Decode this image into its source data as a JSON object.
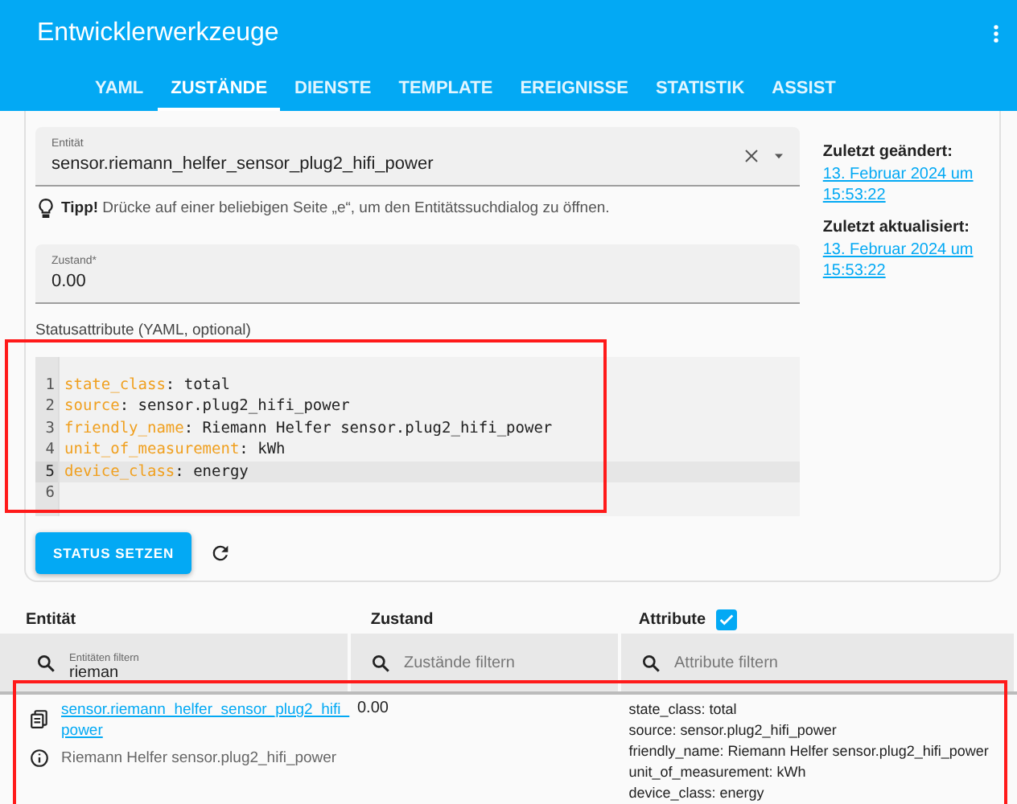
{
  "app_bar": {
    "title": "Entwicklerwerkzeuge"
  },
  "tabs": [
    {
      "label": "YAML",
      "selected": false
    },
    {
      "label": "ZUSTÄNDE",
      "selected": true
    },
    {
      "label": "DIENSTE",
      "selected": false
    },
    {
      "label": "TEMPLATE",
      "selected": false
    },
    {
      "label": "EREIGNISSE",
      "selected": false
    },
    {
      "label": "STATISTIK",
      "selected": false
    },
    {
      "label": "ASSIST",
      "selected": false
    }
  ],
  "entity_field": {
    "label": "Entität",
    "value": "sensor.riemann_helfer_sensor_plug2_hifi_power"
  },
  "tip": "**Tipp!** Drücke auf einer beliebigen Seite „e“, um den Entitätssuchdialog zu öffnen.",
  "state_field": {
    "label": "Zustand*",
    "value": "0.00"
  },
  "attributes_editor": {
    "label": "Statusattribute (YAML, optional)",
    "highlighted": true,
    "lines": [
      {
        "number": "1",
        "key": "state_class",
        "value": ": total",
        "active": false
      },
      {
        "number": "2",
        "key": "source",
        "value": ": sensor.plug2_hifi_power",
        "active": false
      },
      {
        "number": "3",
        "key": "friendly_name",
        "value": ": Riemann Helfer sensor.plug2_hifi_power",
        "active": false
      },
      {
        "number": "4",
        "key": "unit_of_measurement",
        "value": ": kWh",
        "active": false
      },
      {
        "number": "5",
        "key": "device_class",
        "value": ": energy",
        "active": true
      },
      {
        "number": "6",
        "active": false
      }
    ]
  },
  "set_state_button": "STATUS SETZEN",
  "last_changed": {
    "label": "Zuletzt geändert:",
    "value": "13. Februar 2024 um 15:53:22"
  },
  "last_updated": {
    "label": "Zuletzt aktualisiert:",
    "value": "13. Februar 2024 um 15:53:22"
  },
  "table": {
    "columns": [
      {
        "title": "Entität"
      },
      {
        "title": "Zustand"
      },
      {
        "title": "Attribute",
        "checkbox": {
          "checked": true
        }
      }
    ],
    "filters": [
      {
        "label": "Entitäten filtern",
        "value": "rieman"
      },
      {
        "placeholder": "Zustände filtern"
      },
      {
        "placeholder": "Attribute filtern"
      }
    ],
    "rows": [
      {
        "highlighted": true,
        "entity": "sensor.riemann_helfer_sensor_plug2_hifi_power",
        "friendly_name": "Riemann Helfer sensor.plug2_hifi_power",
        "state": "0.00",
        "attributes": [
          "state_class: total",
          "source: sensor.plug2_hifi_power",
          "friendly_name: Riemann Helfer sensor.plug2_hifi_power",
          "unit_of_measurement: kWh",
          "device_class: energy"
        ]
      }
    ]
  }
}
